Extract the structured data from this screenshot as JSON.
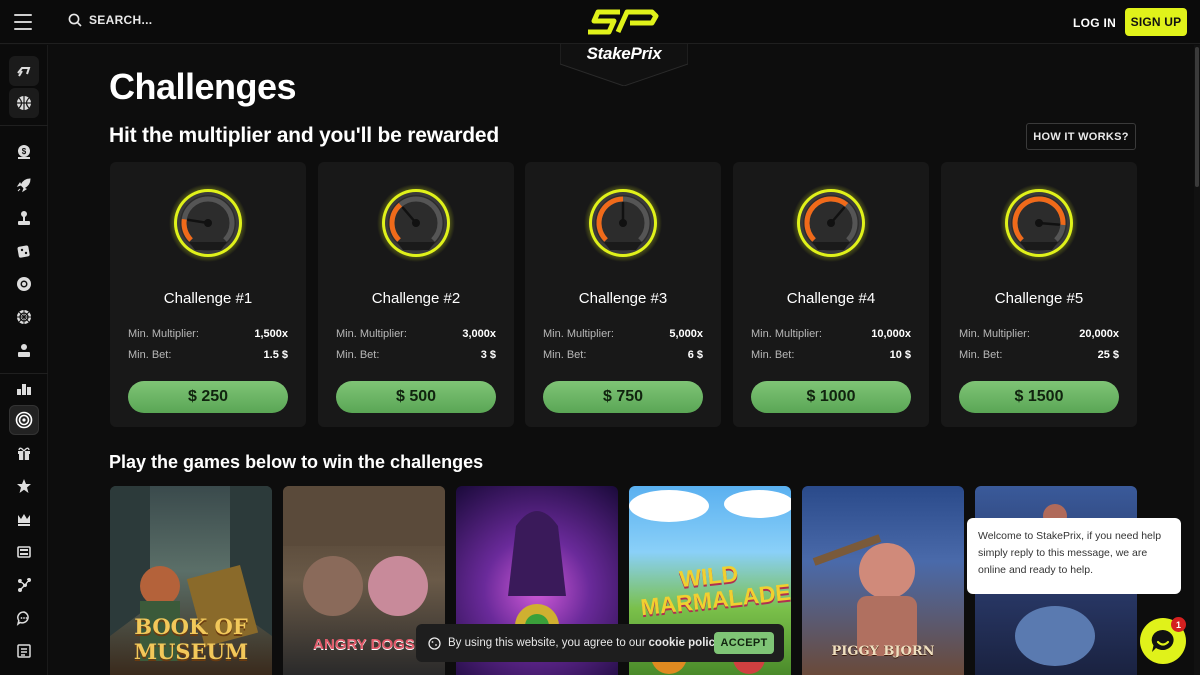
{
  "header": {
    "search_label": "SEARCH...",
    "logo_text": "StakePrix",
    "login_label": "LOG IN",
    "signup_label": "SIGN UP",
    "accent_color": "#e0f21a"
  },
  "sidebar": {
    "items": [
      {
        "icon": "sports-icon"
      },
      {
        "icon": "basketball-icon"
      },
      {
        "icon": "casino-chip-icon"
      },
      {
        "icon": "rocket-icon"
      },
      {
        "icon": "joystick-icon"
      },
      {
        "icon": "dice-icon"
      },
      {
        "icon": "poker-chip-icon"
      },
      {
        "icon": "roulette-icon"
      },
      {
        "icon": "live-dealer-icon"
      },
      {
        "icon": "leaderboard-icon"
      },
      {
        "icon": "challenges-target-icon"
      },
      {
        "icon": "gift-icon"
      },
      {
        "icon": "star-icon"
      },
      {
        "icon": "crown-icon"
      },
      {
        "icon": "news-icon"
      },
      {
        "icon": "affiliate-icon"
      },
      {
        "icon": "chat-icon"
      },
      {
        "icon": "blog-icon"
      }
    ]
  },
  "page": {
    "title": "Challenges",
    "subtitle": "Hit the multiplier and you'll be rewarded",
    "how_label": "HOW IT WORKS?",
    "games_title": "Play the games below to win the challenges"
  },
  "challenges": [
    {
      "title": "Challenge #1",
      "mult_label": "Min. Multiplier:",
      "mult": "1,500x",
      "bet_label": "Min. Bet:",
      "bet": "1.5 $",
      "prize": "$ 250",
      "gauge_level": 0.2
    },
    {
      "title": "Challenge #2",
      "mult_label": "Min. Multiplier:",
      "mult": "3,000x",
      "bet_label": "Min. Bet:",
      "bet": "3 $",
      "prize": "$ 500",
      "gauge_level": 0.35
    },
    {
      "title": "Challenge #3",
      "mult_label": "Min. Multiplier:",
      "mult": "5,000x",
      "bet_label": "Min. Bet:",
      "bet": "6 $",
      "prize": "$ 750",
      "gauge_level": 0.5
    },
    {
      "title": "Challenge #4",
      "mult_label": "Min. Multiplier:",
      "mult": "10,000x",
      "bet_label": "Min. Bet:",
      "bet": "10 $",
      "prize": "$ 1000",
      "gauge_level": 0.65
    },
    {
      "title": "Challenge #5",
      "mult_label": "Min. Multiplier:",
      "mult": "20,000x",
      "bet_label": "Min. Bet:",
      "bet": "25 $",
      "prize": "$ 1500",
      "gauge_level": 0.85
    }
  ],
  "games": [
    {
      "label": "BOOK OF MUSEUM"
    },
    {
      "label": "ANGRY DOGS"
    },
    {
      "label": ""
    },
    {
      "label": "WILD MARMALADE"
    },
    {
      "label": "PIGGY BJORN"
    },
    {
      "label": ""
    }
  ],
  "cookie": {
    "text": "By using this website, you agree to our",
    "policy": "cookie policy",
    "accept": "ACCEPT"
  },
  "chat": {
    "message": "Welcome to StakePrix, if you need help simply reply to this message, we are online and ready to help.",
    "badge": "1"
  }
}
